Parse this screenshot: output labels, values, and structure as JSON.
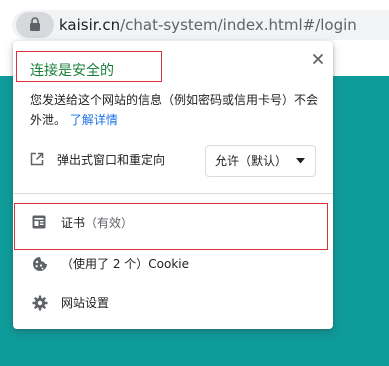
{
  "address_bar": {
    "url_host": "kaisir.cn",
    "url_path": "/chat-system/index.html#/login",
    "lock_icon": "lock-icon"
  },
  "popup": {
    "title": "连接是安全的",
    "description": "您发送给这个网站的信息（例如密码或信用卡号）不会外泄。",
    "learn_more": "了解详情",
    "close_icon": "close-icon",
    "popup_permission": {
      "icon": "open-in-new-icon",
      "label": "弹出式窗口和重定向",
      "select_value": "允许（默认）"
    },
    "certificate": {
      "icon": "certificate-icon",
      "label": "证书",
      "status": "（有效）"
    },
    "cookies": {
      "icon": "cookie-icon",
      "text": "（使用了 2 个）Cookie"
    },
    "site_settings": {
      "icon": "gear-icon",
      "label": "网站设置"
    }
  },
  "colors": {
    "secure_green": "#188038",
    "link_blue": "#1a73e8",
    "page_teal": "#0e9c9a",
    "annotation_red": "#d9303b"
  }
}
